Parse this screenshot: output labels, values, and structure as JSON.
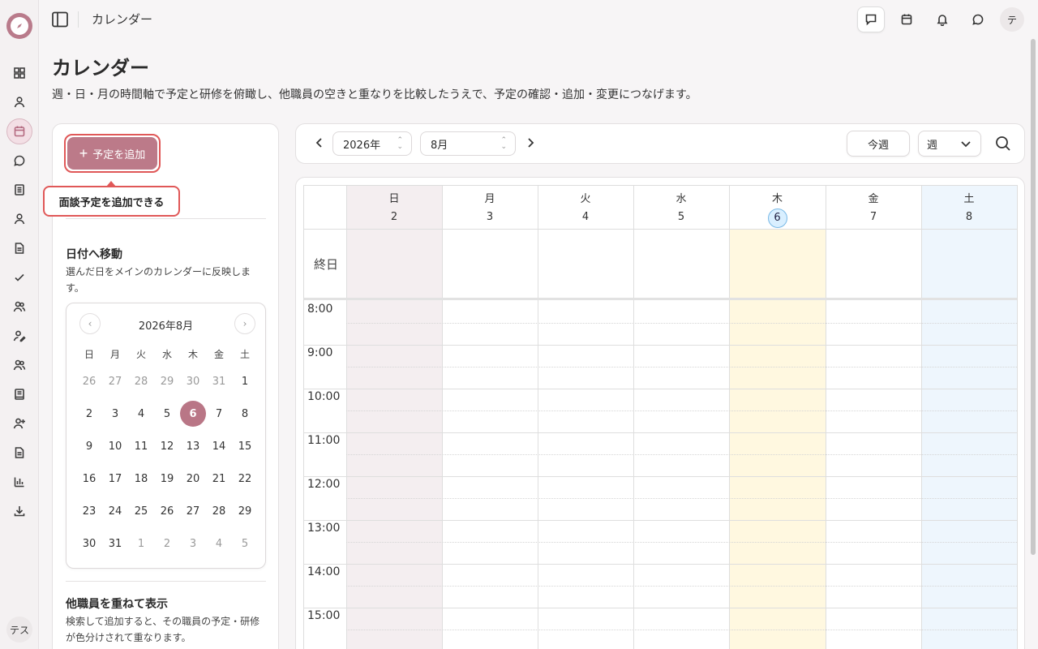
{
  "app": {
    "title": "カレンダー",
    "user_initial_top": "テ",
    "user_initial_rail": "テス"
  },
  "rail": {
    "icons": [
      "dashboard-icon",
      "person-icon",
      "calendar-icon",
      "chat-icon",
      "document-icon",
      "person-icon",
      "file-icon",
      "check-icon",
      "group-icon",
      "person-edit-icon",
      "group-icon",
      "book-icon",
      "person-add-icon",
      "file-icon",
      "bar-chart-icon",
      "download-icon"
    ],
    "active": "calendar-icon"
  },
  "header": {
    "title": "カレンダー",
    "description": "週・日・月の時間軸で予定と研修を俯瞰し、他職員の空きと重なりを比較したうえで、予定の確認・追加・変更につなげます。"
  },
  "panel": {
    "add_button": "予定を追加",
    "tooltip": "面談予定を追加できる",
    "goto_title": "日付へ移動",
    "goto_desc": "選んだ日をメインのカレンダーに反映します。",
    "overlay_title": "他職員を重ねて表示",
    "overlay_desc": "検索して追加すると、その職員の予定・研修が色分けされて重なります。"
  },
  "minical": {
    "title": "2026年8月",
    "weekdays": [
      "日",
      "月",
      "火",
      "水",
      "木",
      "金",
      "土"
    ],
    "weeks": [
      [
        {
          "d": "26",
          "m": true
        },
        {
          "d": "27",
          "m": true
        },
        {
          "d": "28",
          "m": true
        },
        {
          "d": "29",
          "m": true
        },
        {
          "d": "30",
          "m": true
        },
        {
          "d": "31",
          "m": true
        },
        {
          "d": "1"
        }
      ],
      [
        {
          "d": "2"
        },
        {
          "d": "3"
        },
        {
          "d": "4"
        },
        {
          "d": "5"
        },
        {
          "d": "6",
          "sel": true
        },
        {
          "d": "7"
        },
        {
          "d": "8"
        }
      ],
      [
        {
          "d": "9"
        },
        {
          "d": "10"
        },
        {
          "d": "11"
        },
        {
          "d": "12"
        },
        {
          "d": "13"
        },
        {
          "d": "14"
        },
        {
          "d": "15"
        }
      ],
      [
        {
          "d": "16"
        },
        {
          "d": "17"
        },
        {
          "d": "18"
        },
        {
          "d": "19"
        },
        {
          "d": "20"
        },
        {
          "d": "21"
        },
        {
          "d": "22"
        }
      ],
      [
        {
          "d": "23"
        },
        {
          "d": "24"
        },
        {
          "d": "25"
        },
        {
          "d": "26"
        },
        {
          "d": "27"
        },
        {
          "d": "28"
        },
        {
          "d": "29"
        }
      ],
      [
        {
          "d": "30"
        },
        {
          "d": "31"
        },
        {
          "d": "1",
          "m": true
        },
        {
          "d": "2",
          "m": true
        },
        {
          "d": "3",
          "m": true
        },
        {
          "d": "4",
          "m": true
        },
        {
          "d": "5",
          "m": true
        }
      ]
    ]
  },
  "toolbar": {
    "year": "2026年",
    "month": "8月",
    "today_button": "今週",
    "view": "週"
  },
  "week": {
    "days": [
      {
        "name": "日",
        "num": "2",
        "today": false
      },
      {
        "name": "月",
        "num": "3",
        "today": false
      },
      {
        "name": "火",
        "num": "4",
        "today": false
      },
      {
        "name": "水",
        "num": "5",
        "today": false
      },
      {
        "name": "木",
        "num": "6",
        "today": true
      },
      {
        "name": "金",
        "num": "7",
        "today": false
      },
      {
        "name": "土",
        "num": "8",
        "today": false
      }
    ],
    "allday_label": "終日",
    "times": [
      "8:00",
      "9:00",
      "10:00",
      "11:00",
      "12:00",
      "13:00",
      "14:00",
      "15:00"
    ]
  },
  "colors": {
    "accent": "#bc7a89",
    "highlight": "#e05858",
    "sunday_bg": "#f4eef0",
    "today_bg": "#fff8e0",
    "saturday_bg": "#eef6fd"
  }
}
